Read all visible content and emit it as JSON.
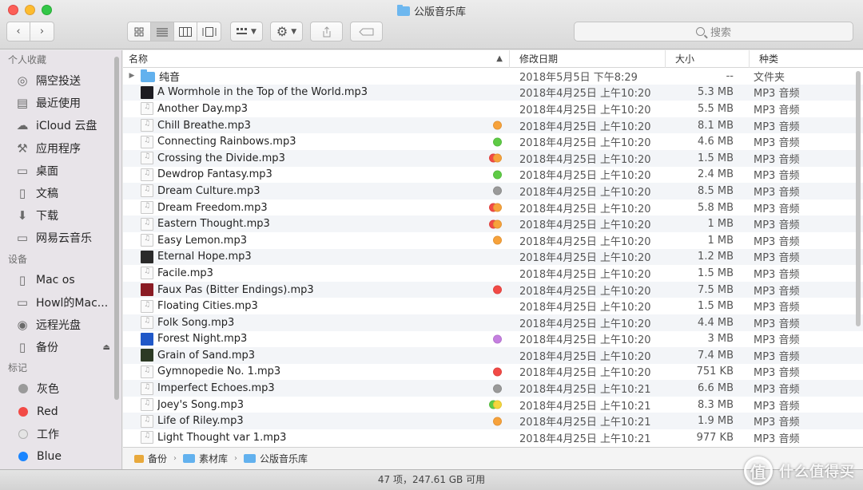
{
  "window": {
    "title": "公版音乐库"
  },
  "toolbar": {
    "back_icon": "chevron-left-icon",
    "forward_icon": "chevron-right-icon",
    "search_placeholder": "搜索"
  },
  "sidebar": {
    "sections": [
      {
        "heading": "个人收藏",
        "items": [
          {
            "label": "隔空投送",
            "icon": "airdrop-icon"
          },
          {
            "label": "最近使用",
            "icon": "recents-icon"
          },
          {
            "label": "iCloud 云盘",
            "icon": "cloud-icon"
          },
          {
            "label": "应用程序",
            "icon": "applications-icon"
          },
          {
            "label": "桌面",
            "icon": "desktop-icon"
          },
          {
            "label": "文稿",
            "icon": "documents-icon"
          },
          {
            "label": "下载",
            "icon": "downloads-icon"
          },
          {
            "label": "网易云音乐",
            "icon": "folder-icon"
          }
        ]
      },
      {
        "heading": "设备",
        "items": [
          {
            "label": "Mac os",
            "icon": "disk-icon"
          },
          {
            "label": "Howl的Mac...",
            "icon": "laptop-icon"
          },
          {
            "label": "远程光盘",
            "icon": "optical-disc-icon"
          },
          {
            "label": "备份",
            "icon": "disk-icon",
            "eject": true
          }
        ]
      },
      {
        "heading": "标记",
        "items": [
          {
            "label": "灰色",
            "color": "#9a9a9a"
          },
          {
            "label": "Red",
            "color": "#f24a46"
          },
          {
            "label": "工作",
            "color": "#e4e4e4"
          },
          {
            "label": "Blue",
            "color": "#1a85ff"
          }
        ]
      }
    ]
  },
  "columns": {
    "name": "名称",
    "date": "修改日期",
    "size": "大小",
    "kind": "种类"
  },
  "files": [
    {
      "name": "纯音",
      "date": "2018年5月5日 下午8:29",
      "size": "--",
      "kind": "文件夹",
      "icon": "folder",
      "tags": [],
      "folder": true
    },
    {
      "name": "A Wormhole in the Top of the World.mp3",
      "date": "2018年4月25日 上午10:20",
      "size": "5.3 MB",
      "kind": "MP3 音频",
      "icon": "art",
      "art": "#1c1c22",
      "tags": []
    },
    {
      "name": "Another Day.mp3",
      "date": "2018年4月25日 上午10:20",
      "size": "5.5 MB",
      "kind": "MP3 音频",
      "icon": "music",
      "tags": []
    },
    {
      "name": "Chill Breathe.mp3",
      "date": "2018年4月25日 上午10:20",
      "size": "8.1 MB",
      "kind": "MP3 音频",
      "icon": "music",
      "tags": [
        "#f7a23b"
      ]
    },
    {
      "name": "Connecting Rainbows.mp3",
      "date": "2018年4月25日 上午10:20",
      "size": "4.6 MB",
      "kind": "MP3 音频",
      "icon": "music",
      "tags": [
        "#5ecb45"
      ]
    },
    {
      "name": "Crossing the Divide.mp3",
      "date": "2018年4月25日 上午10:20",
      "size": "1.5 MB",
      "kind": "MP3 音频",
      "icon": "music",
      "tags": [
        "#f24a46",
        "#f7a23b"
      ]
    },
    {
      "name": "Dewdrop Fantasy.mp3",
      "date": "2018年4月25日 上午10:20",
      "size": "2.4 MB",
      "kind": "MP3 音频",
      "icon": "music",
      "tags": [
        "#5ecb45"
      ]
    },
    {
      "name": "Dream Culture.mp3",
      "date": "2018年4月25日 上午10:20",
      "size": "8.5 MB",
      "kind": "MP3 音频",
      "icon": "music",
      "tags": [
        "#9a9a9a"
      ]
    },
    {
      "name": "Dream Freedom.mp3",
      "date": "2018年4月25日 上午10:20",
      "size": "5.8 MB",
      "kind": "MP3 音频",
      "icon": "music",
      "tags": [
        "#f24a46",
        "#f7a23b"
      ]
    },
    {
      "name": "Eastern Thought.mp3",
      "date": "2018年4月25日 上午10:20",
      "size": "1 MB",
      "kind": "MP3 音频",
      "icon": "music",
      "tags": [
        "#f24a46",
        "#f7a23b"
      ]
    },
    {
      "name": "Easy Lemon.mp3",
      "date": "2018年4月25日 上午10:20",
      "size": "1 MB",
      "kind": "MP3 音频",
      "icon": "music",
      "tags": [
        "#f7a23b"
      ]
    },
    {
      "name": "Eternal Hope.mp3",
      "date": "2018年4月25日 上午10:20",
      "size": "1.2 MB",
      "kind": "MP3 音频",
      "icon": "art",
      "art": "#2a2a2a",
      "tags": []
    },
    {
      "name": "Facile.mp3",
      "date": "2018年4月25日 上午10:20",
      "size": "1.5 MB",
      "kind": "MP3 音频",
      "icon": "music",
      "tags": []
    },
    {
      "name": "Faux Pas (Bitter Endings).mp3",
      "date": "2018年4月25日 上午10:20",
      "size": "7.5 MB",
      "kind": "MP3 音频",
      "icon": "art",
      "art": "#8a1c24",
      "tags": [
        "#f24a46"
      ]
    },
    {
      "name": "Floating Cities.mp3",
      "date": "2018年4月25日 上午10:20",
      "size": "1.5 MB",
      "kind": "MP3 音频",
      "icon": "music",
      "tags": []
    },
    {
      "name": "Folk Song.mp3",
      "date": "2018年4月25日 上午10:20",
      "size": "4.4 MB",
      "kind": "MP3 音频",
      "icon": "music",
      "tags": []
    },
    {
      "name": "Forest Night.mp3",
      "date": "2018年4月25日 上午10:20",
      "size": "3 MB",
      "kind": "MP3 音频",
      "icon": "art",
      "art": "#2058c8",
      "tags": [
        "#c57fe0"
      ]
    },
    {
      "name": "Grain of Sand.mp3",
      "date": "2018年4月25日 上午10:20",
      "size": "7.4 MB",
      "kind": "MP3 音频",
      "icon": "art",
      "art": "#2c3a24",
      "tags": []
    },
    {
      "name": "Gymnopedie No. 1.mp3",
      "date": "2018年4月25日 上午10:20",
      "size": "751 KB",
      "kind": "MP3 音频",
      "icon": "music",
      "tags": [
        "#f24a46"
      ]
    },
    {
      "name": "Imperfect Echoes.mp3",
      "date": "2018年4月25日 上午10:21",
      "size": "6.6 MB",
      "kind": "MP3 音频",
      "icon": "music",
      "tags": [
        "#9a9a9a"
      ]
    },
    {
      "name": "Joey's Song.mp3",
      "date": "2018年4月25日 上午10:21",
      "size": "8.3 MB",
      "kind": "MP3 音频",
      "icon": "music",
      "tags": [
        "#5ecb45",
        "#f5d63c"
      ]
    },
    {
      "name": "Life of Riley.mp3",
      "date": "2018年4月25日 上午10:21",
      "size": "1.9 MB",
      "kind": "MP3 音频",
      "icon": "music",
      "tags": [
        "#f7a23b"
      ]
    },
    {
      "name": "Light Thought var 1.mp3",
      "date": "2018年4月25日 上午10:21",
      "size": "977 KB",
      "kind": "MP3 音频",
      "icon": "music",
      "tags": []
    }
  ],
  "pathbar": [
    {
      "label": "备份",
      "type": "disk"
    },
    {
      "label": "素材库",
      "type": "folder"
    },
    {
      "label": "公版音乐库",
      "type": "folder"
    }
  ],
  "status": "47 项，247.61 GB 可用",
  "watermark": "什么值得买"
}
